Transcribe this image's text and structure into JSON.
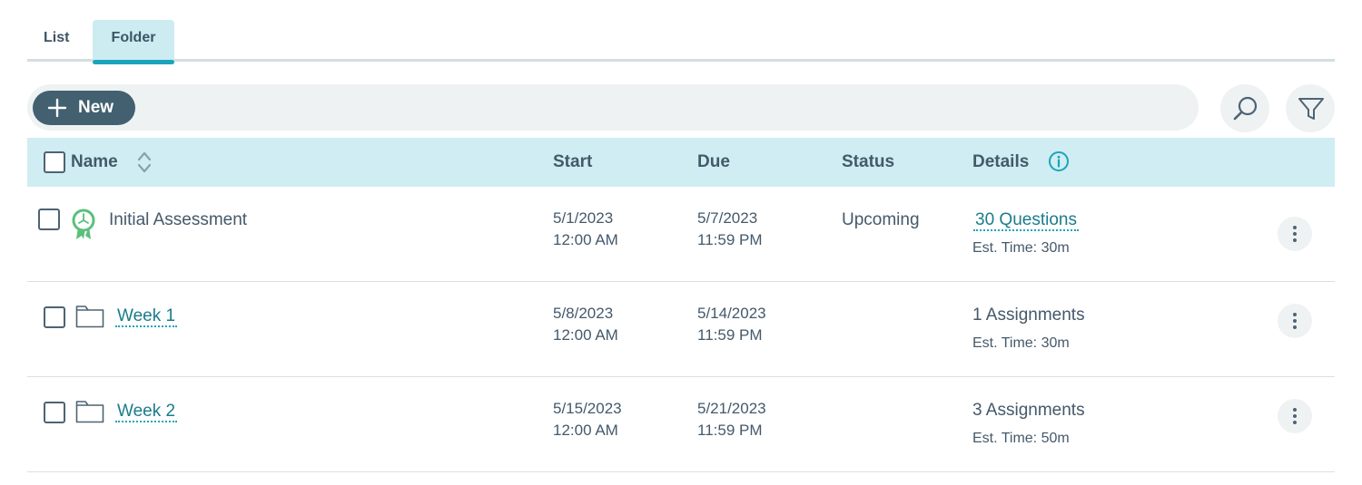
{
  "tabs": [
    {
      "label": "List",
      "active": false
    },
    {
      "label": "Folder",
      "active": true
    }
  ],
  "toolbar": {
    "new_label": "New",
    "search_icon": "search-icon",
    "filter_icon": "filter-icon"
  },
  "table": {
    "columns": {
      "name": "Name",
      "start": "Start",
      "due": "Due",
      "status": "Status",
      "details": "Details"
    },
    "rows": [
      {
        "type": "assessment",
        "icon": "assessment-badge-icon",
        "name": "Initial Assessment",
        "start_date": "5/1/2023",
        "start_time": "12:00 AM",
        "due_date": "5/7/2023",
        "due_time": "11:59 PM",
        "status": "Upcoming",
        "details": "30 Questions",
        "est_time": "Est. Time: 30m"
      },
      {
        "type": "folder",
        "icon": "folder-icon",
        "name": "Week 1",
        "start_date": "5/8/2023",
        "start_time": "12:00 AM",
        "due_date": "5/14/2023",
        "due_time": "11:59 PM",
        "status": "",
        "details": "1 Assignments",
        "est_time": "Est. Time: 30m"
      },
      {
        "type": "folder",
        "icon": "folder-icon",
        "name": "Week 2",
        "start_date": "5/15/2023",
        "start_time": "12:00 AM",
        "due_date": "5/21/2023",
        "due_time": "11:59 PM",
        "status": "",
        "details": "3 Assignments",
        "est_time": "Est. Time: 50m"
      }
    ]
  },
  "colors": {
    "accent": "#1ba4bc",
    "header_bg": "#cfedf2",
    "new_button": "#42606f",
    "link": "#1b7c8a",
    "assessment_icon": "#5cbf7c"
  }
}
